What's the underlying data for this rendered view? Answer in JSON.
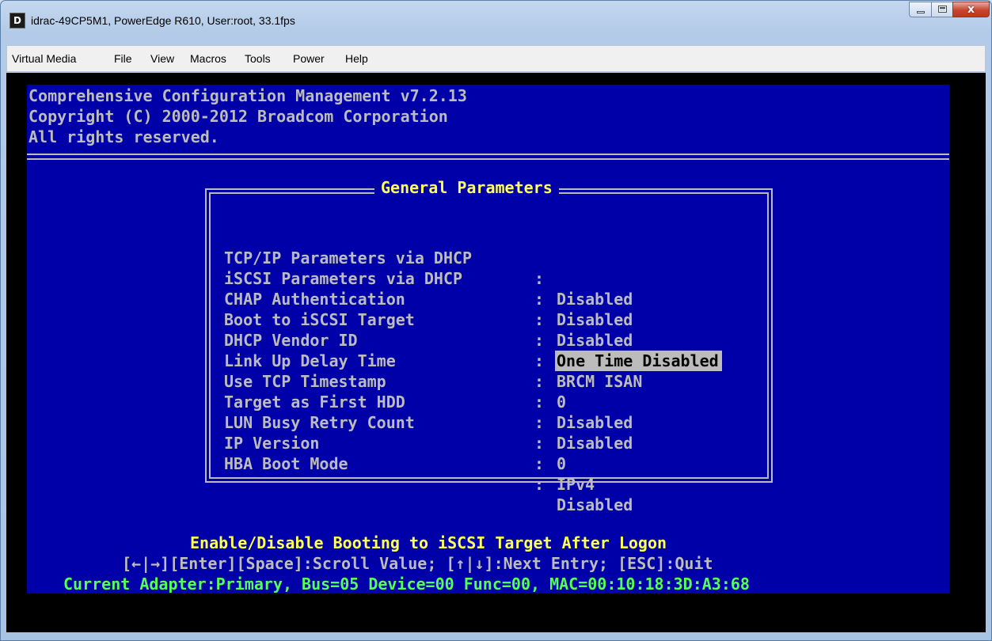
{
  "window": {
    "title": "idrac-49CP5M1, PowerEdge R610, User:root, 33.1fps",
    "app_icon_glyph": "D",
    "close_glyph": "x"
  },
  "menubar": {
    "items": [
      "Virtual Media",
      "File",
      "View",
      "Macros",
      "Tools",
      "Power",
      "Help"
    ]
  },
  "console": {
    "header": [
      "Comprehensive Configuration Management v7.2.13",
      "Copyright (C) 2000-2012 Broadcom Corporation",
      "All rights reserved."
    ],
    "dialog": {
      "title": "General Parameters",
      "rows": [
        {
          "label": "TCP/IP Parameters via DHCP",
          "colon": ":",
          "value": "Disabled"
        },
        {
          "label": "iSCSI Parameters via DHCP",
          "colon": ":",
          "value": "Disabled"
        },
        {
          "label": "CHAP Authentication",
          "colon": ":",
          "value": "Disabled"
        },
        {
          "label": "Boot to iSCSI Target",
          "colon": ":",
          "value": "One Time Disabled",
          "selected": true
        },
        {
          "label": "DHCP Vendor ID",
          "colon": ":",
          "value": "BRCM ISAN"
        },
        {
          "label": "Link Up Delay Time",
          "colon": ":",
          "value": "0"
        },
        {
          "label": "Use TCP Timestamp",
          "colon": ":",
          "value": "Disabled"
        },
        {
          "label": "Target as First HDD",
          "colon": ":",
          "value": "Disabled"
        },
        {
          "label": "LUN Busy Retry Count",
          "colon": ":",
          "value": "0"
        },
        {
          "label": "IP Version",
          "colon": ":",
          "value": "IPv4"
        },
        {
          "label": "HBA Boot Mode",
          "colon": ":",
          "value": "Disabled"
        }
      ]
    },
    "help_text": "Enable/Disable Booting to iSCSI Target After Logon",
    "keys_text": "[←|→][Enter][Space]:Scroll Value; [↑|↓]:Next Entry; [ESC]:Quit",
    "adapter_text": "Current Adapter:Primary, Bus=05 Device=00 Func=00, MAC=00:10:18:3D:A3:68"
  },
  "colors": {
    "console_bg": "#0000a8",
    "text_gray": "#bcbcbc",
    "highlight_yellow": "#ffff55",
    "status_green": "#55ff55"
  }
}
